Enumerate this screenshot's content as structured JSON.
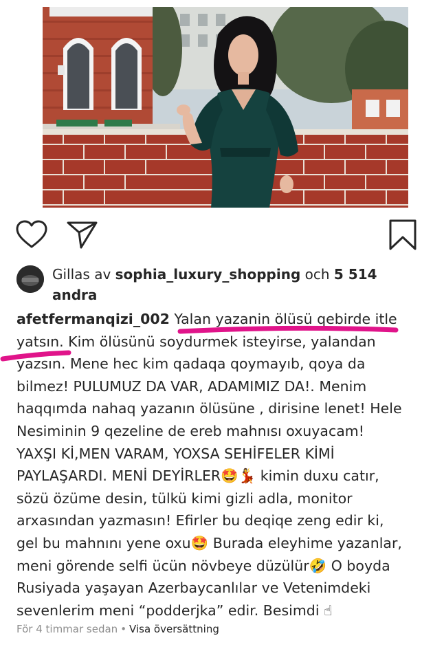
{
  "post": {
    "likes": {
      "prefix": "Gillas av",
      "liker": "sophia_luxury_shopping",
      "connector": "och",
      "count": "5 514",
      "suffix": "andra"
    },
    "caption": {
      "username": "afetfermanqizi_002",
      "lines": [
        "Yalan yazanin ölüsü qebirde itle",
        "yatsın. Kim ölüsünü soydurmek isteyirse, yalandan",
        "yazsın. Mene hec kim qadaqa qoymayıb, qoya da",
        "bilmez! PULUMUZ DA VAR, ADAMIMIZ DA!. Menim",
        "haqqımda nahaq yazanın ölüsüne , dirisine lenet! Hele",
        "Nesiminin 9 qezeline de ereb mahnısı oxuyacam!",
        "YAXŞI Kİ,MEN VARAM, YOXSA SEHİFELER KİMİ",
        "PAYLAŞARDI. MENİ DEYİRLER",
        "sözü özüme desin, tülkü kimi gizli adla, monitor",
        "arxasından yazmasın! Efirler bu deqiqe zeng edir ki,",
        "gel bu mahnını yene oxu",
        "meni görende selfi ücün növbeye düzülür",
        "Rusiyada yaşayan Azerbaycanlılar ve Vetenimdeki",
        "sevenlerim meni “podderjka” edir. Besimdi"
      ],
      "tail_line8": "kimin duxu catır,",
      "tail_line11": "Burada eleyhime yazanlar,",
      "tail_line12": "O boyda",
      "emoji": {
        "star_struck": "🤩",
        "dancer": "💃",
        "rofl": "🤣",
        "point_up": "☝"
      }
    },
    "footer": {
      "time": "För 4 timmar sedan",
      "separator": "•",
      "translate": "Visa översättning"
    },
    "colors": {
      "marker": "#e0148a",
      "text": "#262626",
      "muted": "#8e8e8e"
    },
    "icons": [
      "heart-icon",
      "share-icon",
      "bookmark-icon"
    ]
  }
}
